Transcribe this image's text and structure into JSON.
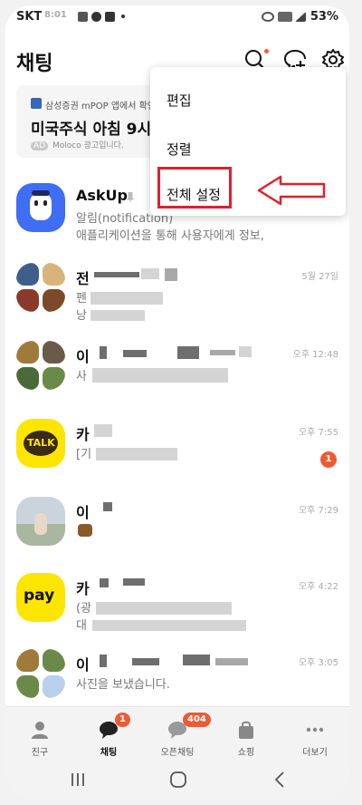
{
  "status_bar": {
    "carrier": "SKT",
    "time": "8:01",
    "battery": "53%"
  },
  "header": {
    "title": "채팅"
  },
  "ad": {
    "source": "삼성증권 mPOP 앱에서 확인",
    "headline": "미국주식 아침 9시",
    "tag": "AD",
    "advertiser": "Moloco 광고입니다."
  },
  "menu": {
    "items": [
      "편집",
      "정렬",
      "전체 설정"
    ]
  },
  "chats": [
    {
      "name": "AskUp",
      "preview_lines": [
        "알림(notification)",
        "애플리케이션을 통해 사용자에게 정보,"
      ],
      "time": "",
      "badge": ""
    },
    {
      "name": "전",
      "preview_lines": [
        "펜",
        "낭"
      ],
      "time": "5월 27일",
      "badge": ""
    },
    {
      "name": "이",
      "preview_lines": [
        "사"
      ],
      "time": "오후 12:48",
      "badge": ""
    },
    {
      "name": "카",
      "preview_lines": [
        "[기"
      ],
      "time": "오후 7:55",
      "badge": "1"
    },
    {
      "name": "이",
      "preview_lines": [
        ""
      ],
      "time": "오후 7:29",
      "badge": ""
    },
    {
      "name": "카",
      "preview_lines": [
        "(광",
        "대"
      ],
      "time": "오후 4:22",
      "badge": ""
    },
    {
      "name": "이",
      "preview_lines": [
        "사진을 보냈습니다."
      ],
      "time": "오후 3:05",
      "badge": ""
    }
  ],
  "avatars": {
    "talk_text": "TALK",
    "pay_text": "pay",
    "kakao_yellow": "#fee500"
  },
  "bottom_nav": {
    "items": [
      {
        "label": "친구",
        "icon": "person-icon",
        "badge": ""
      },
      {
        "label": "채팅",
        "icon": "chat-bubble-icon",
        "badge": "1"
      },
      {
        "label": "오픈채팅",
        "icon": "open-chat-icon",
        "badge": "404"
      },
      {
        "label": "쇼핑",
        "icon": "shopping-bag-icon",
        "badge": ""
      },
      {
        "label": "더보기",
        "icon": "more-dots-icon",
        "badge": ""
      }
    ]
  },
  "colors": {
    "accent_red": "#e0202a",
    "badge": "#ef5a34"
  }
}
